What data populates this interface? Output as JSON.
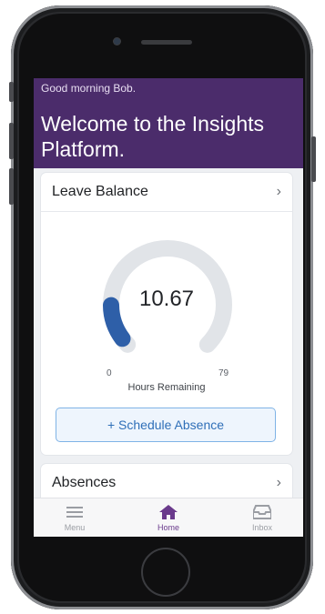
{
  "header": {
    "greeting": "Good morning Bob.",
    "welcome": "Welcome to the Insights Platform."
  },
  "leave_balance": {
    "title": "Leave Balance",
    "value": "10.67",
    "min": "0",
    "max": "79",
    "caption": "Hours Remaining",
    "fraction": 0.135
  },
  "schedule_button": {
    "label": "+ Schedule Absence"
  },
  "absences": {
    "title": "Absences"
  },
  "tabbar": {
    "tabs": [
      {
        "label": "Menu",
        "icon": "menu-icon",
        "active": false
      },
      {
        "label": "Home",
        "icon": "home-icon",
        "active": true
      },
      {
        "label": "Inbox",
        "icon": "inbox-icon",
        "active": false
      }
    ]
  },
  "colors": {
    "header": "#4b2c6b",
    "accent": "#2e5fa8",
    "active_tab": "#6a3a8c",
    "inactive_tab": "#9a9da3"
  }
}
